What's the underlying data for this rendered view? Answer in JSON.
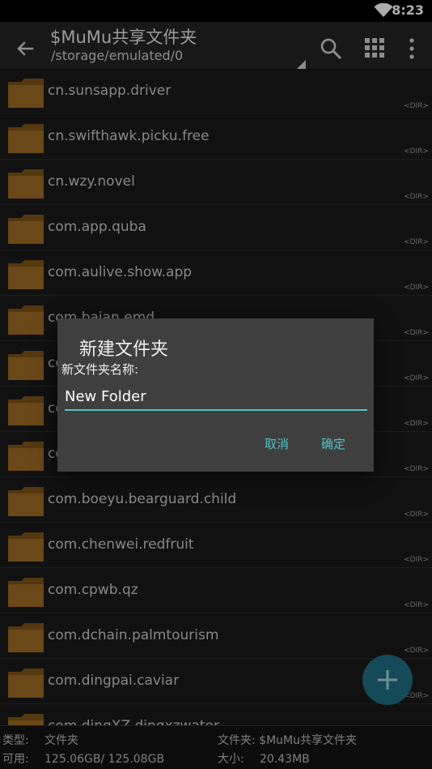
{
  "status_bar": {
    "time": "8:23"
  },
  "app_bar": {
    "title": "$MuMu共享文件夹",
    "path": "/storage/emulated/0"
  },
  "file_list": {
    "items": [
      {
        "name": "cn.sunsapp.driver",
        "tag": "<DIR>"
      },
      {
        "name": "cn.swifthawk.picku.free",
        "tag": "<DIR>"
      },
      {
        "name": "cn.wzy.novel",
        "tag": "<DIR>"
      },
      {
        "name": "com.app.quba",
        "tag": "<DIR>"
      },
      {
        "name": "com.aulive.show.app",
        "tag": "<DIR>"
      },
      {
        "name": "com.baian.emd",
        "tag": "<DIR>"
      },
      {
        "name": "co",
        "tag": "<DIR>"
      },
      {
        "name": "co",
        "tag": "<DIR>"
      },
      {
        "name": "co",
        "tag": "<DIR>"
      },
      {
        "name": "com.boeyu.bearguard.child",
        "tag": "<DIR>"
      },
      {
        "name": "com.chenwei.redfruit",
        "tag": "<DIR>"
      },
      {
        "name": "com.cpwb.qz",
        "tag": "<DIR>"
      },
      {
        "name": "com.dchain.palmtourism",
        "tag": "<DIR>"
      },
      {
        "name": "com.dingpai.caviar",
        "tag": "<DIR>"
      },
      {
        "name": "com.dingXZ.dingxzwater",
        "tag": ""
      }
    ]
  },
  "info_bar": {
    "type_label": "类型:",
    "type_value": "文件夹",
    "folder_label": "文件夹:",
    "folder_value": "$MuMu共享文件夹",
    "available_label": "可用:",
    "available_value": "125.06GB/ 125.08GB",
    "size_label": "大小:",
    "size_value": "20.43MB"
  },
  "dialog": {
    "title": "新建文件夹",
    "label": "新文件夹名称:",
    "input_value": "New Folder",
    "cancel_label": "取消",
    "ok_label": "确定"
  },
  "colors": {
    "accent": "#4fc3c4",
    "fab": "#1f6e82",
    "folder": "#9c6a22",
    "dialog_bg": "#3f3f3f"
  },
  "icons": {
    "back": "arrow-left-icon",
    "search": "search-icon",
    "grid": "grid-view-icon",
    "more": "more-vertical-icon",
    "folder": "folder-icon",
    "fab": "plus-icon",
    "wifi": "wifi-icon"
  }
}
